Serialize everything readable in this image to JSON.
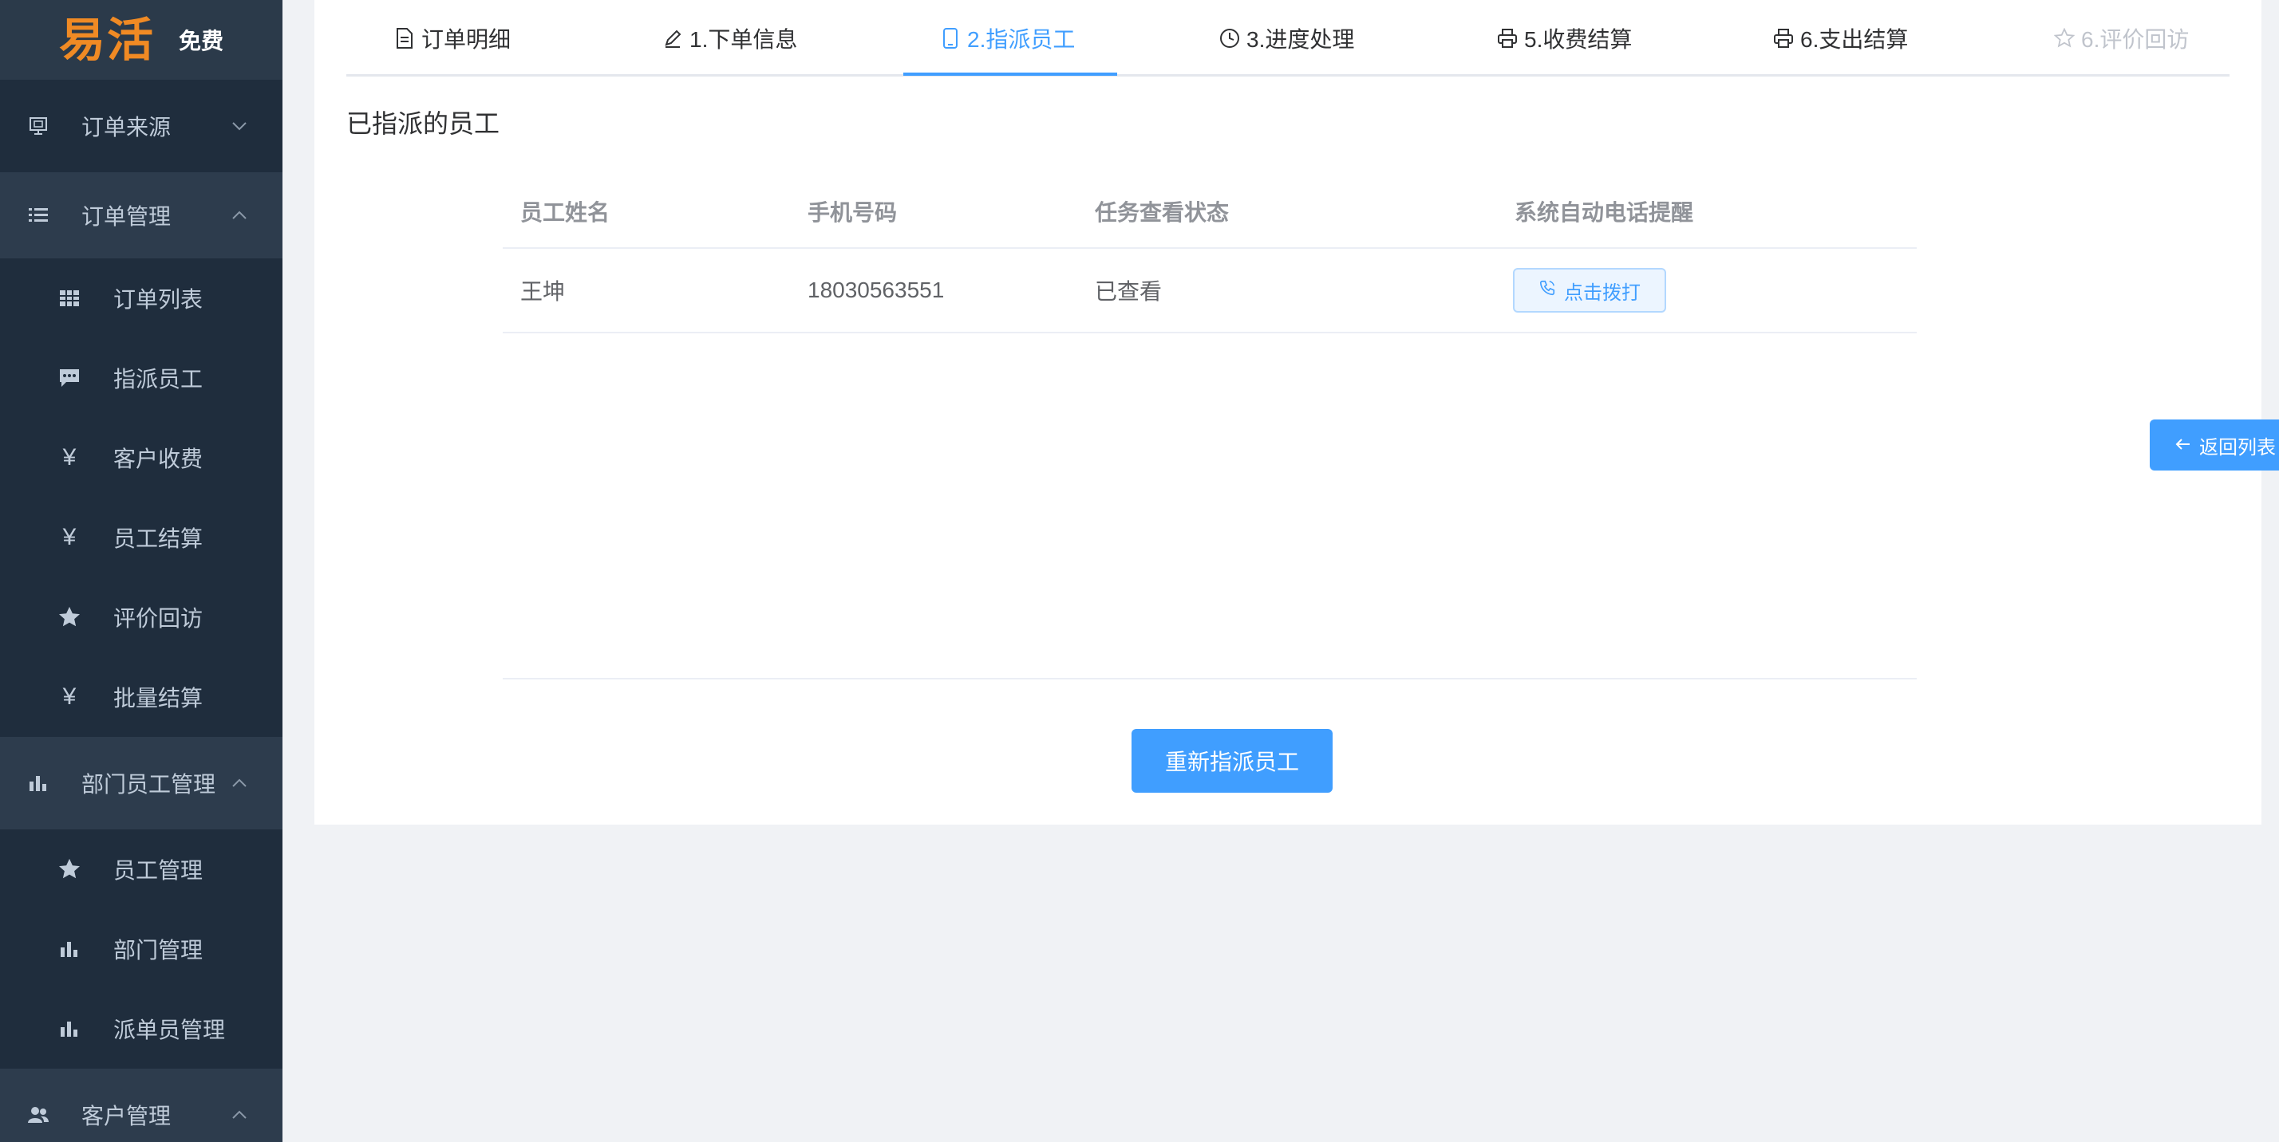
{
  "brand": {
    "logo_text": "易活",
    "badge": "免费",
    "logo_color": "#f08a24"
  },
  "sidebar": {
    "groups": [
      {
        "label": "订单来源",
        "icon": "order-source-icon",
        "expanded": false,
        "children": []
      },
      {
        "label": "订单管理",
        "icon": "list-icon",
        "expanded": true,
        "children": [
          {
            "label": "订单列表",
            "icon": "grid-icon"
          },
          {
            "label": "指派员工",
            "icon": "chat-icon"
          },
          {
            "label": "客户收费",
            "icon": "yen-icon",
            "glyph": "¥"
          },
          {
            "label": "员工结算",
            "icon": "yen-icon",
            "glyph": "¥"
          },
          {
            "label": "评价回访",
            "icon": "star-icon"
          },
          {
            "label": "批量结算",
            "icon": "yen-icon",
            "glyph": "¥"
          }
        ]
      },
      {
        "label": "部门员工管理",
        "icon": "bar-chart-icon",
        "expanded": true,
        "children": [
          {
            "label": "员工管理",
            "icon": "star-icon"
          },
          {
            "label": "部门管理",
            "icon": "bar-chart-icon"
          },
          {
            "label": "派单员管理",
            "icon": "bar-chart-icon"
          }
        ]
      },
      {
        "label": "客户管理",
        "icon": "users-icon",
        "expanded": true,
        "children": []
      }
    ]
  },
  "tabs": [
    {
      "label": "订单明细",
      "icon": "document-icon",
      "state": "normal"
    },
    {
      "label": "1.下单信息",
      "icon": "edit-icon",
      "state": "normal"
    },
    {
      "label": "2.指派员工",
      "icon": "mobile-icon",
      "state": "active"
    },
    {
      "label": "3.进度处理",
      "icon": "clock-icon",
      "state": "normal"
    },
    {
      "label": "5.收费结算",
      "icon": "printer-icon",
      "state": "normal"
    },
    {
      "label": "6.支出结算",
      "icon": "printer-icon",
      "state": "normal"
    },
    {
      "label": "6.评价回访",
      "icon": "star-outline-icon",
      "state": "disabled"
    }
  ],
  "section_title": "已指派的员工",
  "table": {
    "headers": [
      "员工姓名",
      "手机号码",
      "任务查看状态",
      "系统自动电话提醒"
    ],
    "rows": [
      {
        "name": "王坤",
        "phone": "18030563551",
        "status": "已查看",
        "action": "点击拨打"
      }
    ]
  },
  "reassign_button": "重新指派员工",
  "back_button": "返回列表",
  "colors": {
    "accent": "#409eff",
    "sidebar_bg": "#1f2d3d",
    "sidebar_open_bg": "#2d3c4d",
    "page_bg": "#f0f2f5"
  }
}
